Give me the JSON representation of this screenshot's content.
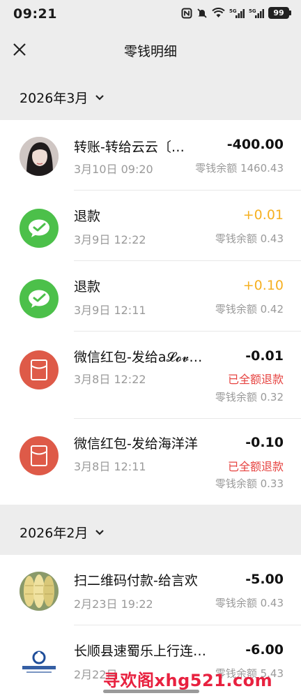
{
  "status_bar": {
    "time": "09:21",
    "battery": "99",
    "network_1": "5G",
    "network_2": "5G"
  },
  "nav": {
    "title": "零钱明细",
    "close_icon": "close-icon"
  },
  "months": [
    {
      "label": "2026年3月",
      "transactions": [
        {
          "title": "转账-转给云云〔…",
          "date": "3月10日 09:20",
          "amount": "-400.00",
          "balance": "零钱余额 1460.43",
          "avatar": "user-photo",
          "positive": false
        },
        {
          "title": "退款",
          "date": "3月9日 12:22",
          "amount": "+0.01",
          "balance": "零钱余额 0.43",
          "avatar": "wechat-icon",
          "positive": true
        },
        {
          "title": "退款",
          "date": "3月9日 12:11",
          "amount": "+0.10",
          "balance": "零钱余额 0.42",
          "avatar": "wechat-icon",
          "positive": true
        },
        {
          "title": "微信红包-发给a𝓛𝓸𝓿…",
          "date": "3月8日 12:22",
          "amount": "-0.01",
          "status": "已全额退款",
          "balance": "零钱余额 0.32",
          "avatar": "red-packet-icon",
          "positive": false
        },
        {
          "title": "微信红包-发给海洋洋",
          "date": "3月8日 12:11",
          "amount": "-0.10",
          "status": "已全额退款",
          "balance": "零钱余额 0.33",
          "avatar": "red-packet-icon",
          "positive": false
        }
      ]
    },
    {
      "label": "2026年2月",
      "transactions": [
        {
          "title": "扫二维码付款-给言欢",
          "date": "2月23日 19:22",
          "amount": "-5.00",
          "balance": "零钱余额 0.43",
          "avatar": "corn-photo",
          "positive": false
        },
        {
          "title": "长顺县速蜀乐上行连…",
          "date": "2月22日",
          "amount": "-6.00",
          "balance": "零钱余额 5.43",
          "avatar": "bank-logo",
          "positive": false
        }
      ]
    }
  ],
  "watermark": "寻欢阁xhg521.com",
  "colors": {
    "background": "#ededed",
    "positive_amount": "#f6b021",
    "refund_text": "#e64340",
    "wechat_green": "#4cc04a",
    "red_packet": "#de5a48"
  }
}
